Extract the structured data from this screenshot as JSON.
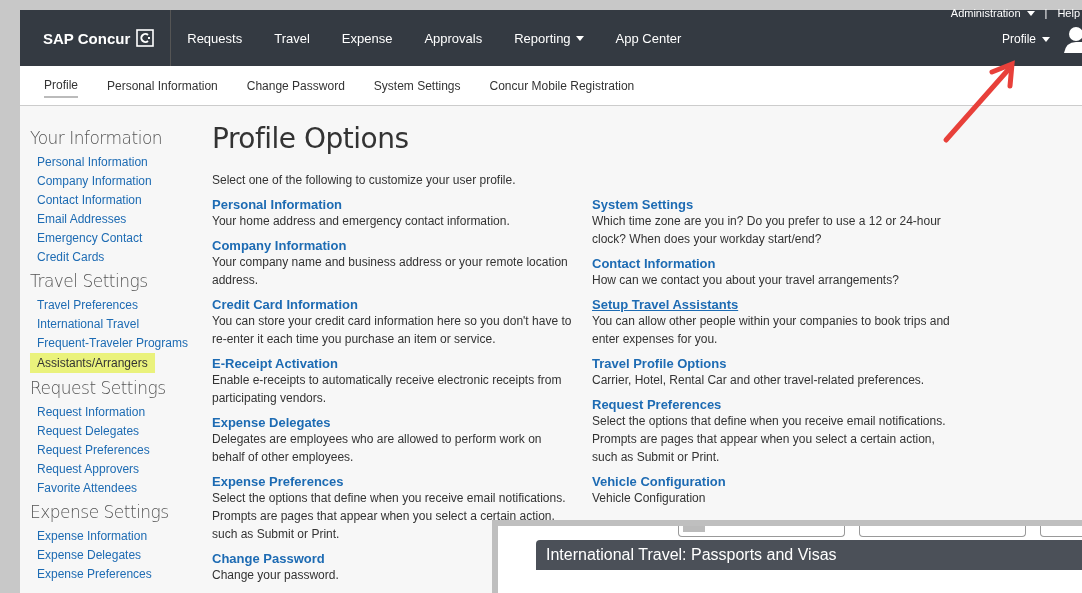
{
  "header": {
    "brand": "SAP Concur",
    "nav": [
      {
        "label": "Requests",
        "dropdown": false
      },
      {
        "label": "Travel",
        "dropdown": false
      },
      {
        "label": "Expense",
        "dropdown": false
      },
      {
        "label": "Approvals",
        "dropdown": false
      },
      {
        "label": "Reporting",
        "dropdown": true
      },
      {
        "label": "App Center",
        "dropdown": false
      }
    ],
    "admin": "Administration",
    "separator": "|",
    "help": "Help",
    "user_menu": "Profile"
  },
  "subnav": [
    {
      "label": "Profile",
      "selected": true
    },
    {
      "label": "Personal Information",
      "selected": false
    },
    {
      "label": "Change Password",
      "selected": false
    },
    {
      "label": "System Settings",
      "selected": false
    },
    {
      "label": "Concur Mobile Registration",
      "selected": false
    }
  ],
  "sidebar": [
    {
      "heading": "Your Information",
      "items": [
        {
          "label": "Personal Information",
          "highlighted": false
        },
        {
          "label": "Company Information",
          "highlighted": false
        },
        {
          "label": "Contact Information",
          "highlighted": false
        },
        {
          "label": "Email Addresses",
          "highlighted": false
        },
        {
          "label": "Emergency Contact",
          "highlighted": false
        },
        {
          "label": "Credit Cards",
          "highlighted": false
        }
      ]
    },
    {
      "heading": "Travel Settings",
      "items": [
        {
          "label": "Travel Preferences",
          "highlighted": false
        },
        {
          "label": "International Travel",
          "highlighted": false
        },
        {
          "label": "Frequent-Traveler Programs",
          "highlighted": false
        },
        {
          "label": "Assistants/Arrangers",
          "highlighted": true
        }
      ]
    },
    {
      "heading": "Request Settings",
      "items": [
        {
          "label": "Request Information",
          "highlighted": false
        },
        {
          "label": "Request Delegates",
          "highlighted": false
        },
        {
          "label": "Request Preferences",
          "highlighted": false
        },
        {
          "label": "Request Approvers",
          "highlighted": false
        },
        {
          "label": "Favorite Attendees",
          "highlighted": false
        }
      ]
    },
    {
      "heading": "Expense Settings",
      "items": [
        {
          "label": "Expense Information",
          "highlighted": false
        },
        {
          "label": "Expense Delegates",
          "highlighted": false
        },
        {
          "label": "Expense Preferences",
          "highlighted": false
        }
      ]
    }
  ],
  "title": "Profile Options",
  "intro": "Select one of the following to customize your user profile.",
  "options_left": [
    {
      "title": "Personal Information",
      "description": "Your home address and emergency contact information.",
      "underlined": false
    },
    {
      "title": "Company Information",
      "description": "Your company name and business address or your remote location address.",
      "underlined": false
    },
    {
      "title": "Credit Card Information",
      "description": "You can store your credit card information here so you don't have to re-enter it each time you purchase an item or service.",
      "underlined": false
    },
    {
      "title": "E-Receipt Activation",
      "description": "Enable e-receipts to automatically receive electronic receipts from participating vendors.",
      "underlined": false
    },
    {
      "title": "Expense Delegates",
      "description": "Delegates are employees who are allowed to perform work on behalf of other employees.",
      "underlined": false
    },
    {
      "title": "Expense Preferences",
      "description": "Select the options that define when you receive email notifications. Prompts are pages that appear when you select a certain action, such as Submit or Print.",
      "underlined": false
    },
    {
      "title": "Change Password",
      "description": "Change your password.",
      "underlined": false
    }
  ],
  "options_right": [
    {
      "title": "System Settings",
      "description": "Which time zone are you in? Do you prefer to use a 12 or 24-hour clock? When does your workday start/end?",
      "underlined": false
    },
    {
      "title": "Contact Information",
      "description": "How can we contact you about your travel arrangements?",
      "underlined": false
    },
    {
      "title": "Setup Travel Assistants",
      "description": "You can allow other people within your companies to book trips and enter expenses for you.",
      "underlined": true
    },
    {
      "title": "Travel Profile Options",
      "description": "Carrier, Hotel, Rental Car and other travel-related preferences.",
      "underlined": false
    },
    {
      "title": "Request Preferences",
      "description": "Select the options that define when you receive email notifications. Prompts are pages that appear when you select a certain action, such as Submit or Print.",
      "underlined": false
    },
    {
      "title": "Vehicle Configuration",
      "description": "Vehicle Configuration",
      "underlined": false
    }
  ],
  "inset": {
    "title": "International Travel: Passports and Visas"
  }
}
